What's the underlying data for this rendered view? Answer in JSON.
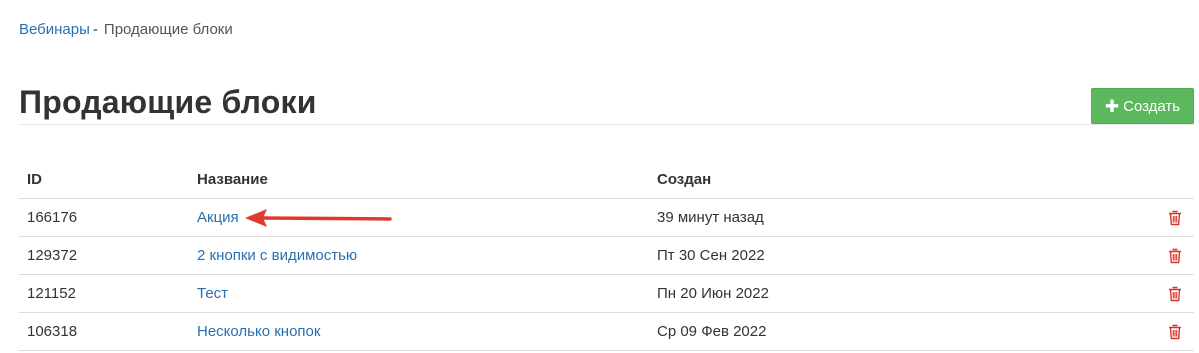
{
  "breadcrumb": {
    "parent_label": "Вебинары",
    "separator": "-",
    "current_label": "Продающие блоки"
  },
  "header": {
    "title": "Продающие блоки",
    "create_button_label": "Создать",
    "create_button_icon": "plus-icon"
  },
  "table": {
    "columns": {
      "id": "ID",
      "name": "Название",
      "created": "Создан"
    },
    "rows": [
      {
        "id": "166176",
        "name": "Акция",
        "created": "39 минут назад"
      },
      {
        "id": "129372",
        "name": "2 кнопки с видимостью",
        "created": "Пт 30 Сен 2022"
      },
      {
        "id": "121152",
        "name": "Тест",
        "created": "Пн 20 Июн 2022"
      },
      {
        "id": "106318",
        "name": "Несколько кнопок",
        "created": "Ср 09 Фев 2022"
      }
    ],
    "row_action_icon": "trash-icon"
  },
  "colors": {
    "link": "#2a6fb0",
    "create_button": "#5cb85c",
    "delete_icon": "#d9342b",
    "annotation_arrow": "#e03a2f"
  }
}
